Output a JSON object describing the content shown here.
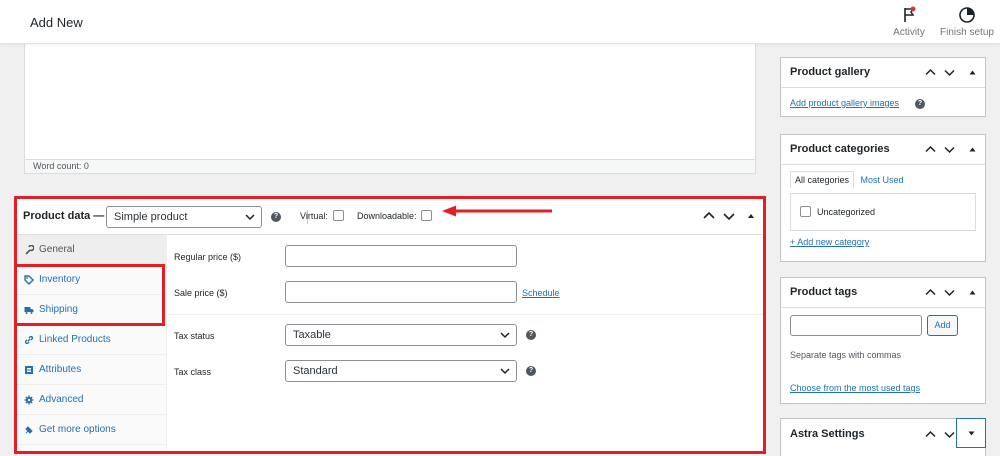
{
  "header": {
    "title": "Add New",
    "activity_label": "Activity",
    "finish_setup_label": "Finish setup"
  },
  "editor": {
    "word_count": "Word count: 0"
  },
  "product_data": {
    "label": "Product data —",
    "type_selected": "Simple product",
    "virtual_label": "Virtual:",
    "downloadable_label": "Downloadable:",
    "tabs": [
      {
        "label": "General",
        "icon": "wrench-icon"
      },
      {
        "label": "Inventory",
        "icon": "tag-icon"
      },
      {
        "label": "Shipping",
        "icon": "truck-icon"
      },
      {
        "label": "Linked Products",
        "icon": "link-icon"
      },
      {
        "label": "Attributes",
        "icon": "list-icon"
      },
      {
        "label": "Advanced",
        "icon": "gear-icon"
      },
      {
        "label": "Get more options",
        "icon": "plugin-icon"
      }
    ],
    "regular_price_label": "Regular price ($)",
    "sale_price_label": "Sale price ($)",
    "schedule_link": "Schedule",
    "tax_status_label": "Tax status",
    "tax_status_value": "Taxable",
    "tax_class_label": "Tax class",
    "tax_class_value": "Standard"
  },
  "sidebar": {
    "gallery": {
      "title": "Product gallery",
      "add_link": "Add product gallery images"
    },
    "categories": {
      "title": "Product categories",
      "tab_all": "All categories",
      "tab_most_used": "Most Used",
      "item": "Uncategorized",
      "add_link": "+ Add new category"
    },
    "tags": {
      "title": "Product tags",
      "add_button": "Add",
      "help_text": "Separate tags with commas",
      "choose_link": "Choose from the most used tags"
    },
    "astra": {
      "title": "Astra Settings"
    }
  },
  "colors": {
    "accent": "#2271b1",
    "highlight_red": "#e01f26",
    "notification_dot": "#d63638"
  }
}
